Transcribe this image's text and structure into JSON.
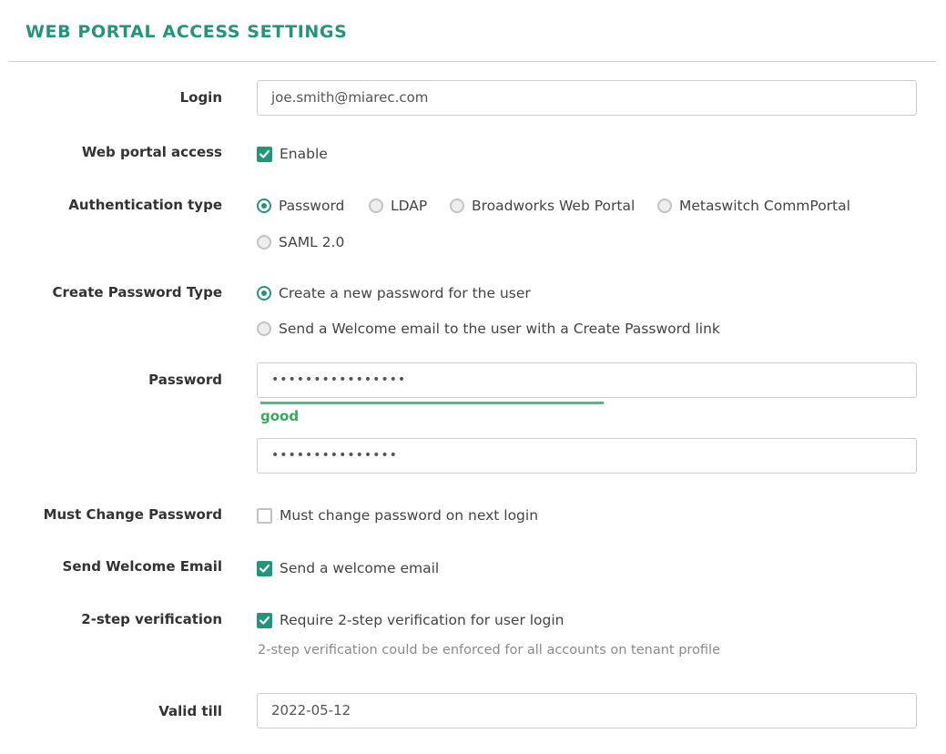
{
  "section": {
    "title": "WEB PORTAL ACCESS SETTINGS"
  },
  "login": {
    "label": "Login",
    "value": "joe.smith@miarec.com"
  },
  "web_portal_access": {
    "label": "Web portal access",
    "option": "Enable",
    "checked": true
  },
  "authentication_type": {
    "label": "Authentication type",
    "options": [
      "Password",
      "LDAP",
      "Broadworks Web Portal",
      "Metaswitch CommPortal",
      "SAML 2.0"
    ],
    "selected": "Password"
  },
  "create_password_type": {
    "label": "Create Password Type",
    "options": [
      "Create a new password for the user",
      "Send a Welcome email to the user with a Create Password link"
    ],
    "selected": "Create a new password for the user"
  },
  "password": {
    "label": "Password",
    "value": "••••••••••••••••",
    "strength_text": "good",
    "strength_level": 0.52,
    "confirm_value": "•••••••••••••••"
  },
  "must_change_password": {
    "label": "Must Change Password",
    "option": "Must change password on next login",
    "checked": false
  },
  "send_welcome_email": {
    "label": "Send Welcome Email",
    "option": "Send a welcome email",
    "checked": true
  },
  "two_step": {
    "label": "2-step verification",
    "option": "Require 2-step verification for user login",
    "checked": true,
    "help": "2-step verification could be enforced for all accounts on tenant profile"
  },
  "valid_till": {
    "label": "Valid till",
    "value": "2022-05-12"
  },
  "colors": {
    "accent": "#23957a",
    "strength": "#4cbf7a"
  }
}
